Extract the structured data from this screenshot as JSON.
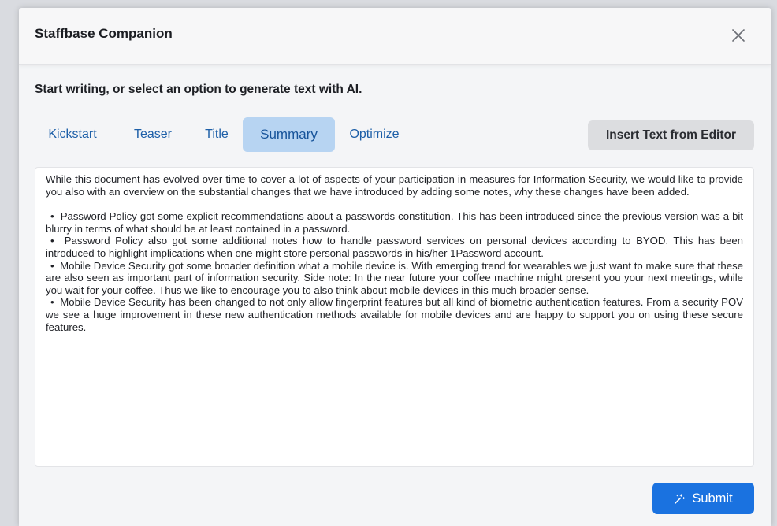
{
  "dialog": {
    "title": "Staffbase Companion",
    "close_icon": "close-icon"
  },
  "instruction": "Start writing, or select an option to generate text with AI.",
  "tabs": [
    {
      "label": "Kickstart",
      "active": false
    },
    {
      "label": "Teaser",
      "active": false
    },
    {
      "label": "Title",
      "active": false
    },
    {
      "label": "Summary",
      "active": true
    },
    {
      "label": "Optimize",
      "active": false
    }
  ],
  "insert_button": {
    "label": "Insert Text from Editor"
  },
  "editor": {
    "intro": "While this document has evolved over time to cover a lot of aspects of your participation in measures for Information Security, we would like to provide you also with an overview on the substantial changes that we have introduced by adding some notes, why these changes have been added.",
    "bullets": [
      "Password Policy got some explicit recommendations about a passwords constitution. This has been introduced since the previous version was a bit blurry in terms of what should be at least contained in a password.",
      "Password Policy also got some additional notes how to handle password services on personal devices according to BYOD. This has been introduced to highlight implications when one might store personal passwords in his/her 1Password account.",
      "Mobile Device Security got some broader definition what a mobile device is. With emerging trend for wearables we just want to make sure that these are also seen as important part of information security. Side note: In the near future your coffee machine might present you your next meetings, while you wait for your coffee. Thus we like to encourage you to also think about mobile devices in this much broader sense.",
      "Mobile Device Security has been changed to not only allow fingerprint features but all kind of biometric authentication features. From a security POV we see a huge improvement in these new authentication methods available for mobile devices and are happy to support you on using these secure features."
    ]
  },
  "submit_button": {
    "label": "Submit",
    "icon": "magic-wand-icon"
  },
  "colors": {
    "accent": "#1a72e0",
    "tab_text": "#1d5fa8",
    "tab_active_bg": "#b7d4f2"
  }
}
